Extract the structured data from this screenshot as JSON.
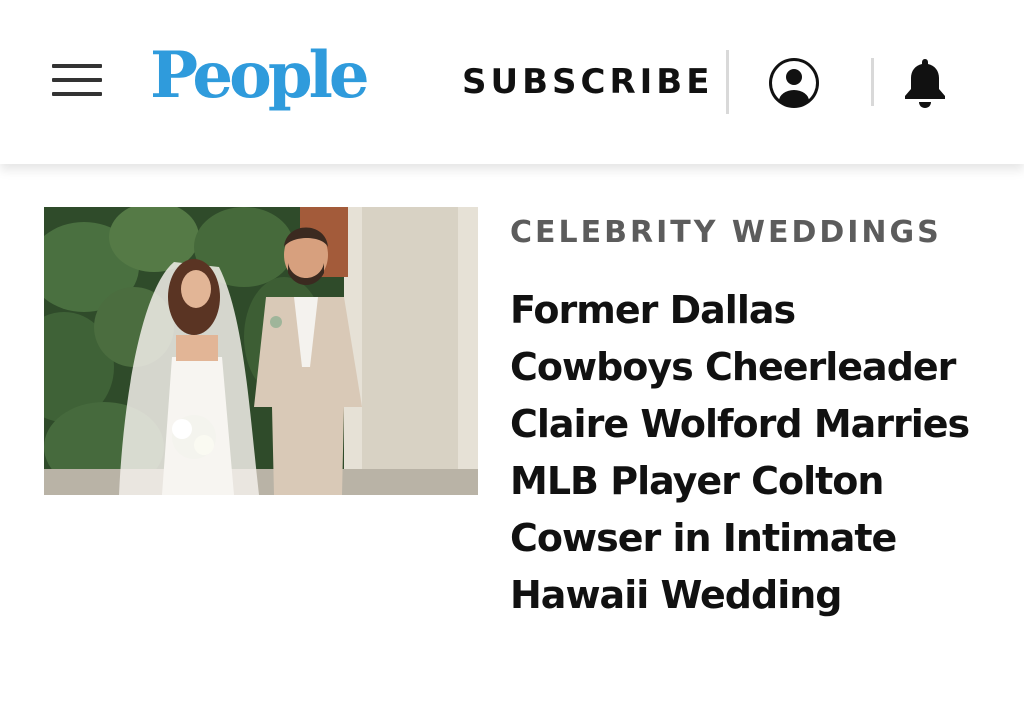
{
  "header": {
    "logo_text": "People",
    "subscribe_label": "SUBSCRIBE",
    "menu_icon": "hamburger-menu-icon",
    "account_icon": "account-circle-icon",
    "notification_icon": "bell-icon",
    "logo_color": "#2f9bdc"
  },
  "article": {
    "category": "CELEBRITY WEDDINGS",
    "headline": "Former Dallas Cowboys Cheerleader Claire Wolford Marries MLB Player Colton Cowser in Intimate Hawaii Wedding",
    "image": "wedding-couple-photo"
  }
}
